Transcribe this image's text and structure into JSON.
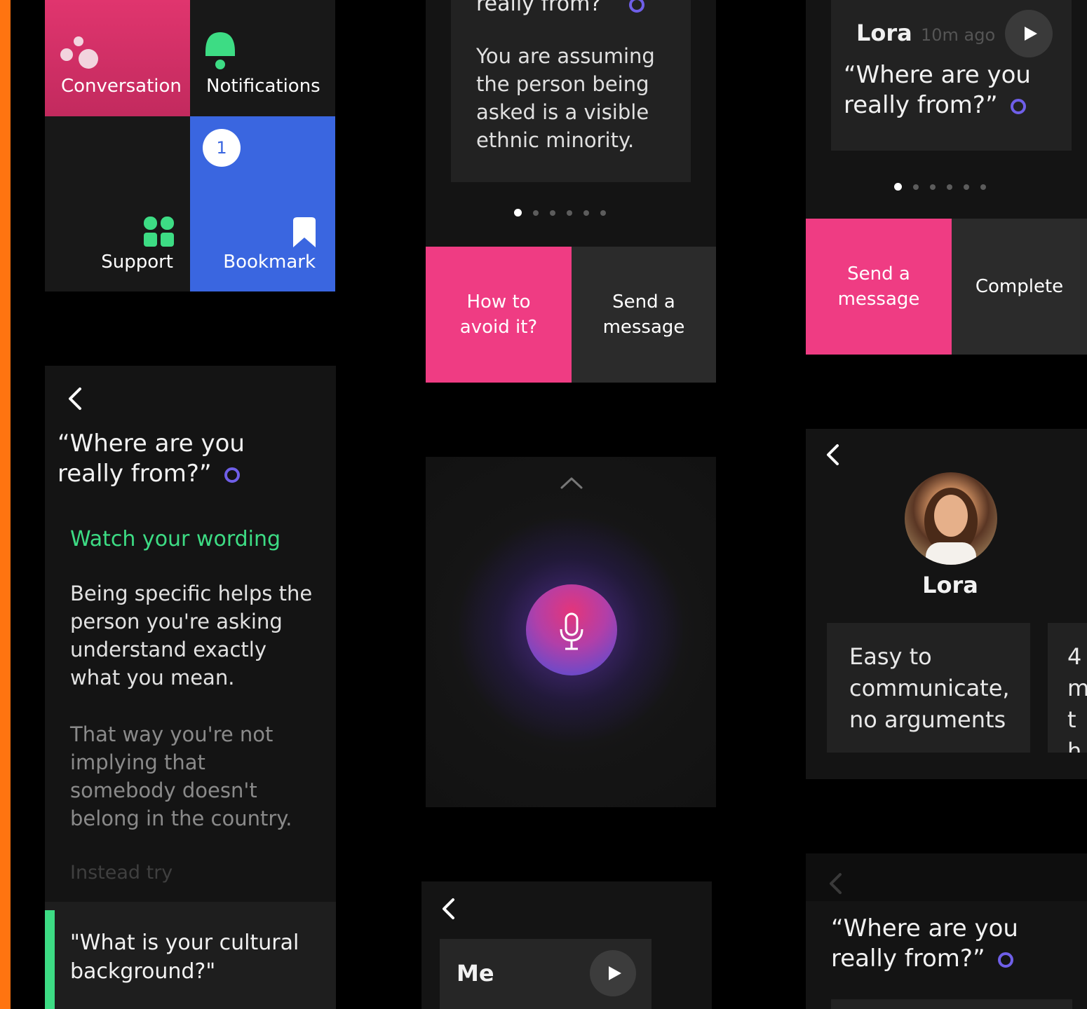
{
  "tiles": {
    "conversation": "Conversation",
    "notifications": "Notifications",
    "support": "Support",
    "bookmark": "Bookmark",
    "bookmark_badge": "1"
  },
  "detail_left": {
    "question": "“Where are you really from?”",
    "heading": "Watch your wording",
    "para1": "Being specific helps the person you're asking understand exactly what you mean.",
    "para2": "That way you're not implying that somebody doesn't belong in the country.",
    "instead": "Instead try",
    "suggestion": "\"What is your cultural background?\""
  },
  "middle_top": {
    "question_fragment": "really from?”",
    "explanation": "You are assuming the person being asked is a visible ethnic minority.",
    "btn_avoid": "How to avoid it?",
    "btn_send": "Send a message",
    "dots_total": 6,
    "dots_active": 0
  },
  "voice": {
    "icons": [
      "chevron-up-icon",
      "microphone-icon"
    ]
  },
  "me_card": {
    "name": "Me"
  },
  "right_top": {
    "name": "Lora",
    "time": "10m ago",
    "question": "“Where are you really from?”",
    "btn_send": "Send a message",
    "btn_complete": "Complete",
    "dots_total": 6,
    "dots_active": 0
  },
  "profile": {
    "name": "Lora",
    "card1": "Easy to communicate, no arguments",
    "card2_fragment": "4 m th"
  },
  "right_bottom": {
    "question": "“Where are you really from?”"
  },
  "colors": {
    "pink": "#ef3c83",
    "blue": "#3a66e0",
    "green": "#3ddc84",
    "ring": "#6f5fe8",
    "stripe": "#ff7410"
  }
}
